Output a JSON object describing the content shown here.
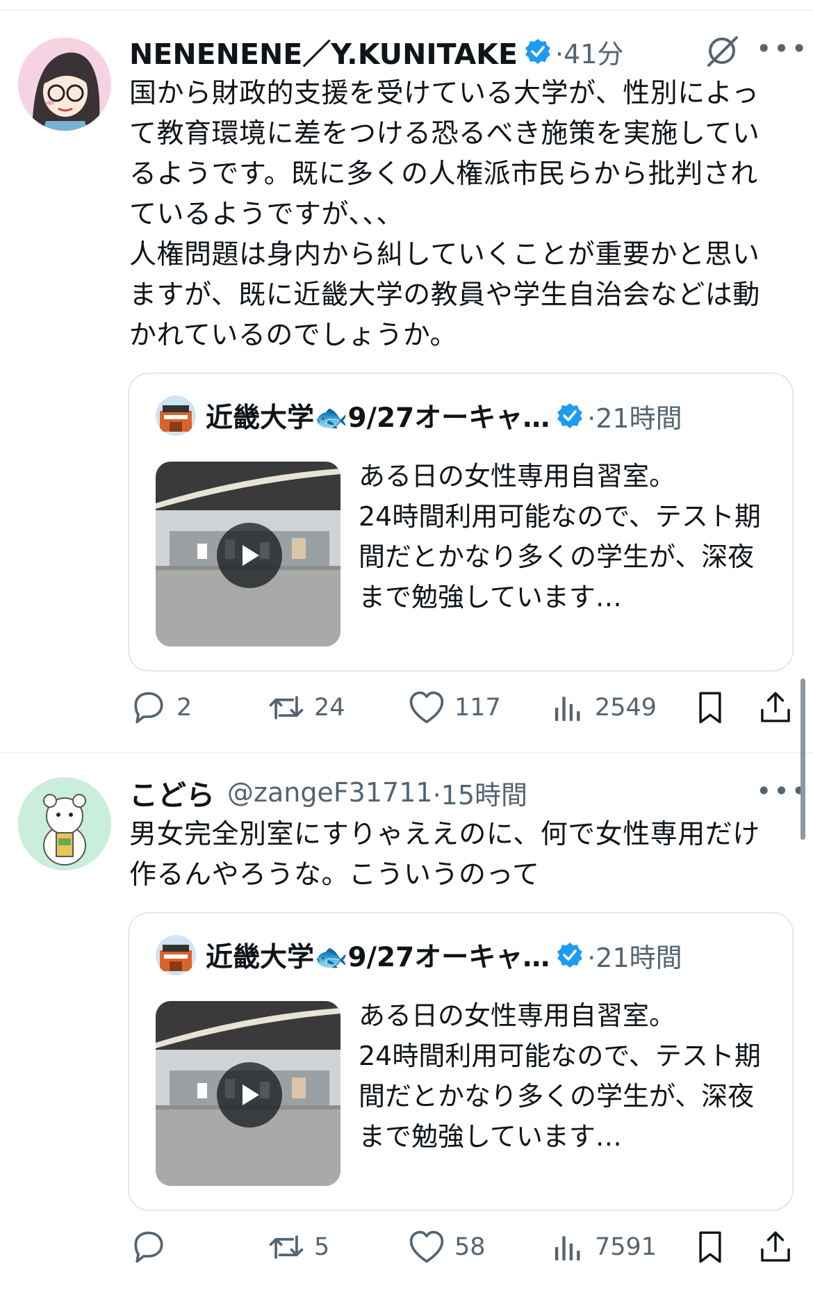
{
  "colors": {
    "text_primary": "#0f1419",
    "text_secondary": "#536471",
    "verified_blue": "#1d9bf0",
    "divider": "#eff3f4"
  },
  "posts": [
    {
      "author_name": "NENENENE／Y.KUNITAKE",
      "verified": true,
      "time": "·41分",
      "text": "国から財政的支援を受けている大学が、性別によって教育環境に差をつける恐るべき施策を実施しているようです。既に多くの人権派市民らから批判されているようですが、、、\n人権問題は身内から糾していくことが重要かと思いますが、既に近畿大学の教員や学生自治会などは動かれているのでしょうか。",
      "quote": {
        "author_name": "近畿大学🐟9/27オーキャ…",
        "verified": true,
        "time": "·21時間",
        "text": "ある日の女性専用自習室。\n24時間利用可能なので、テスト期間だとかなり多くの学生が、深夜まで勉強しています…"
      },
      "stats": {
        "replies": "2",
        "reposts": "24",
        "likes": "117",
        "views": "2549"
      }
    },
    {
      "author_name": "こどら",
      "handle": "@zangeF31711",
      "time": "·15時間",
      "text": "男女完全別室にすりゃええのに、何で女性専用だけ作るんやろうな。こういうのって",
      "quote": {
        "author_name": "近畿大学🐟9/27オーキャ…",
        "verified": true,
        "time": "·21時間",
        "text": "ある日の女性専用自習室。\n24時間利用可能なので、テスト期間だとかなり多くの学生が、深夜まで勉強しています…"
      },
      "stats": {
        "replies": "",
        "reposts": "5",
        "likes": "58",
        "views": "7591"
      }
    }
  ],
  "icons": [
    "grok-icon",
    "more-icon",
    "reply-icon",
    "repost-icon",
    "like-icon",
    "views-icon",
    "bookmark-icon",
    "share-icon",
    "play-icon",
    "verified-badge-icon"
  ]
}
